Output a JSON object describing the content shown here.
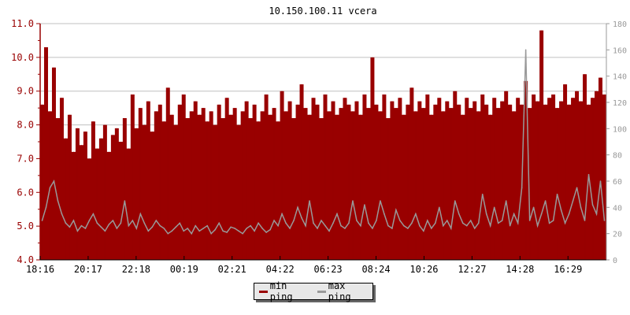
{
  "chart_data": {
    "type": "area",
    "title": "10.150.100.11 vcera",
    "xlabel": "",
    "ylabel_left": "",
    "ylabel_right": "",
    "ylim_left": [
      4.0,
      11.0
    ],
    "ylim_right": [
      0,
      180
    ],
    "left_ticks": [
      "4.0",
      "5.0",
      "6.0",
      "7.0",
      "8.0",
      "9.0",
      "10.0",
      "11.0"
    ],
    "right_ticks": [
      "0",
      "20",
      "40",
      "60",
      "80",
      "100",
      "120",
      "140",
      "160",
      "180"
    ],
    "x_tick_labels": [
      "18:16",
      "20:17",
      "22:18",
      "00:19",
      "02:21",
      "04:22",
      "06:23",
      "08:24",
      "10:26",
      "12:27",
      "14:28",
      "16:29"
    ],
    "grid": true,
    "legend_position": "bottom-center",
    "colors": {
      "min_ping": "#990000",
      "max_ping": "#999999",
      "left_axis": "#990000",
      "right_axis": "#999999",
      "grid": "#c0c0c0"
    },
    "series": [
      {
        "name": "min ping",
        "axis": "left",
        "values": [
          8.6,
          10.3,
          8.4,
          9.7,
          8.2,
          8.8,
          7.6,
          8.3,
          7.2,
          7.9,
          7.4,
          7.8,
          7.0,
          8.1,
          7.3,
          7.6,
          8.0,
          7.2,
          7.7,
          7.9,
          7.5,
          8.2,
          7.3,
          8.9,
          7.9,
          8.5,
          8.0,
          8.7,
          7.8,
          8.4,
          8.6,
          8.1,
          9.1,
          8.3,
          8.0,
          8.6,
          8.9,
          8.2,
          8.4,
          8.7,
          8.3,
          8.5,
          8.1,
          8.4,
          8.0,
          8.6,
          8.2,
          8.8,
          8.3,
          8.5,
          8.0,
          8.4,
          8.7,
          8.2,
          8.6,
          8.1,
          8.4,
          8.9,
          8.3,
          8.5,
          8.1,
          9.0,
          8.4,
          8.7,
          8.2,
          8.6,
          9.2,
          8.5,
          8.3,
          8.8,
          8.6,
          8.2,
          8.9,
          8.4,
          8.7,
          8.3,
          8.5,
          8.8,
          8.6,
          8.4,
          8.7,
          8.3,
          8.9,
          8.5,
          10.0,
          8.6,
          8.4,
          8.9,
          8.2,
          8.7,
          8.5,
          8.8,
          8.3,
          8.6,
          9.1,
          8.4,
          8.7,
          8.5,
          8.9,
          8.3,
          8.6,
          8.8,
          8.4,
          8.7,
          8.5,
          9.0,
          8.6,
          8.3,
          8.8,
          8.5,
          8.7,
          8.4,
          8.9,
          8.6,
          8.3,
          8.8,
          8.5,
          8.7,
          9.0,
          8.6,
          8.4,
          8.8,
          8.6,
          9.3,
          8.5,
          8.9,
          8.7,
          10.8,
          8.6,
          8.8,
          8.9,
          8.5,
          8.7,
          9.2,
          8.6,
          8.8,
          9.0,
          8.7,
          9.5,
          8.6,
          8.8,
          9.0,
          9.4,
          8.9
        ]
      },
      {
        "name": "max ping",
        "axis": "right",
        "values": [
          30,
          40,
          55,
          60,
          45,
          35,
          28,
          25,
          30,
          22,
          26,
          24,
          30,
          35,
          28,
          25,
          22,
          27,
          30,
          24,
          28,
          45,
          26,
          30,
          24,
          35,
          28,
          22,
          25,
          30,
          26,
          24,
          20,
          22,
          25,
          28,
          22,
          24,
          20,
          26,
          22,
          24,
          26,
          20,
          23,
          28,
          22,
          21,
          25,
          24,
          22,
          20,
          24,
          26,
          22,
          28,
          24,
          21,
          23,
          30,
          26,
          35,
          28,
          24,
          30,
          40,
          32,
          26,
          45,
          28,
          24,
          30,
          26,
          22,
          28,
          35,
          26,
          24,
          28,
          45,
          30,
          26,
          42,
          28,
          24,
          30,
          45,
          35,
          26,
          24,
          38,
          30,
          26,
          24,
          28,
          35,
          26,
          22,
          30,
          24,
          28,
          40,
          26,
          30,
          24,
          45,
          35,
          28,
          26,
          30,
          24,
          28,
          50,
          35,
          26,
          40,
          28,
          30,
          45,
          26,
          35,
          28,
          55,
          160,
          30,
          40,
          26,
          35,
          45,
          28,
          30,
          50,
          38,
          28,
          35,
          45,
          55,
          40,
          30,
          65,
          42,
          35,
          60,
          30
        ]
      }
    ]
  }
}
